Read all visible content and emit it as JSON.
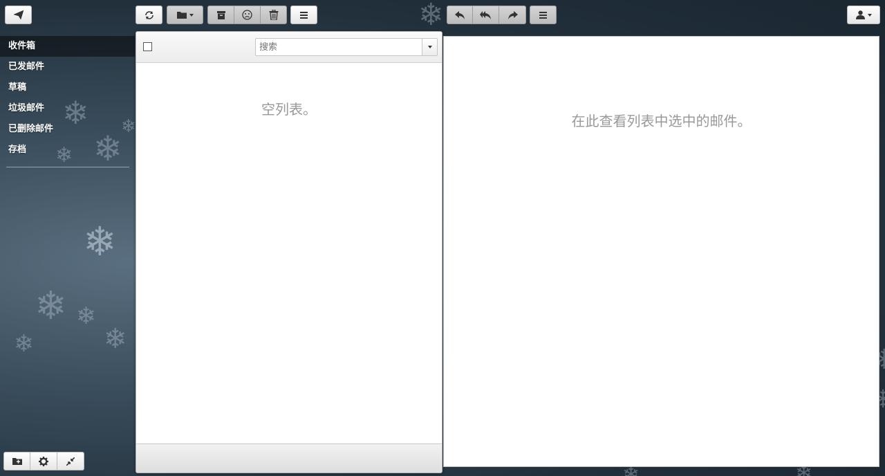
{
  "icons": {
    "compose": "paper-plane-icon",
    "refresh": "refresh-icon",
    "move": "folder-icon",
    "archive": "archive-icon",
    "spam": "sad-face-icon",
    "delete": "trash-icon",
    "more": "menu-icon",
    "reply": "reply-icon",
    "reply_all": "reply-all-icon",
    "forward": "forward-icon",
    "account": "user-icon",
    "new_folder": "add-folder-icon",
    "settings": "gear-icon",
    "collapse": "collapse-icon"
  },
  "sidebar": {
    "folders": [
      {
        "label": "收件箱",
        "active": true
      },
      {
        "label": "已发邮件",
        "active": false
      },
      {
        "label": "草稿",
        "active": false
      },
      {
        "label": "垃圾邮件",
        "active": false
      },
      {
        "label": "已删除邮件",
        "active": false
      },
      {
        "label": "存档",
        "active": false
      }
    ]
  },
  "message_list": {
    "search_placeholder": "搜索",
    "empty_text": "空列表。"
  },
  "preview": {
    "empty_text": "在此查看列表中选中的邮件。"
  }
}
